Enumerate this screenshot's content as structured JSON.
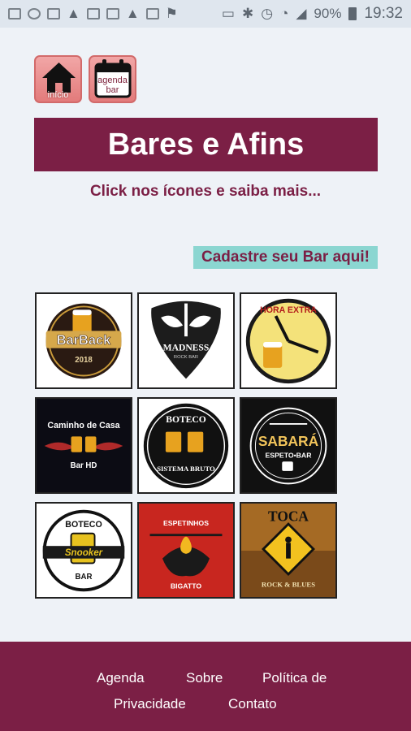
{
  "status_bar": {
    "battery": "90%",
    "time": "19:32"
  },
  "nav": {
    "home_label": "início",
    "agenda_label_line1": "agenda",
    "agenda_label_line2": "bar"
  },
  "banner": {
    "title": "Bares e Afins"
  },
  "subtitle": "Click nos ícones e saiba mais...",
  "cta": {
    "label": "Cadastre seu Bar aqui!"
  },
  "bars": [
    {
      "name": "BarBack",
      "year": "2018"
    },
    {
      "name": "MADNESS",
      "tagline": "ROCK BAR"
    },
    {
      "name": "HORA EXTRA"
    },
    {
      "name": "Caminho de Casa",
      "subtitle": "Bar HD"
    },
    {
      "name": "BOTECO",
      "subtitle": "SISTEMA BRUTO"
    },
    {
      "name": "SABARÁ",
      "subtitle": "ESPETO•BAR"
    },
    {
      "name": "BOTECO",
      "middle": "Snooker",
      "subtitle": "BAR"
    },
    {
      "name": "ESPETINHOS",
      "subtitle": "BIGATTO"
    },
    {
      "name": "TOCA",
      "subtitle": "ROCK & BLUES"
    }
  ],
  "footer": {
    "links": [
      "Agenda",
      "Sobre",
      "Política de",
      "Privacidade",
      "Contato"
    ]
  },
  "colors": {
    "brand": "#7b1f45",
    "accent": "#8bd6d1",
    "background": "#eef2f7"
  }
}
